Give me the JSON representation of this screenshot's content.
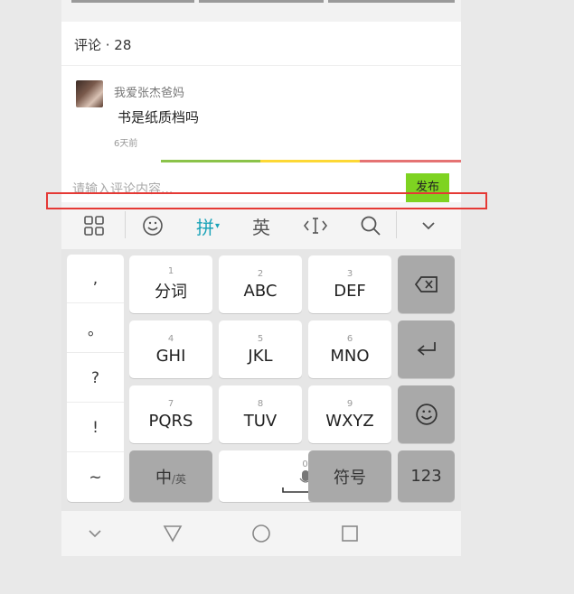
{
  "comments": {
    "header": "评论 · 28",
    "items": [
      {
        "author": "我爱张杰爸妈",
        "content": "书是纸质档吗",
        "time": "6天前"
      }
    ]
  },
  "input": {
    "placeholder": "请输入评论内容...",
    "send_label": "发布"
  },
  "keyboard": {
    "toolbar": {
      "pinyin_label": "拼",
      "english_label": "英"
    },
    "punctuation": [
      ",",
      "。",
      "?",
      "!",
      "~"
    ],
    "keys": [
      {
        "num": "1",
        "label": "分词"
      },
      {
        "num": "2",
        "label": "ABC"
      },
      {
        "num": "3",
        "label": "DEF"
      },
      {
        "num": "4",
        "label": "GHI"
      },
      {
        "num": "5",
        "label": "JKL"
      },
      {
        "num": "6",
        "label": "MNO"
      },
      {
        "num": "7",
        "label": "PQRS"
      },
      {
        "num": "8",
        "label": "TUV"
      },
      {
        "num": "9",
        "label": "WXYZ"
      }
    ],
    "bottom": {
      "lang_main": "中",
      "lang_sub": "/英",
      "space_num": "0",
      "symbols": "符号",
      "numbers": "123"
    }
  },
  "colors": {
    "accent": "#7ed321",
    "pinyin": "#1aa3b8",
    "highlight": "#e53935"
  }
}
